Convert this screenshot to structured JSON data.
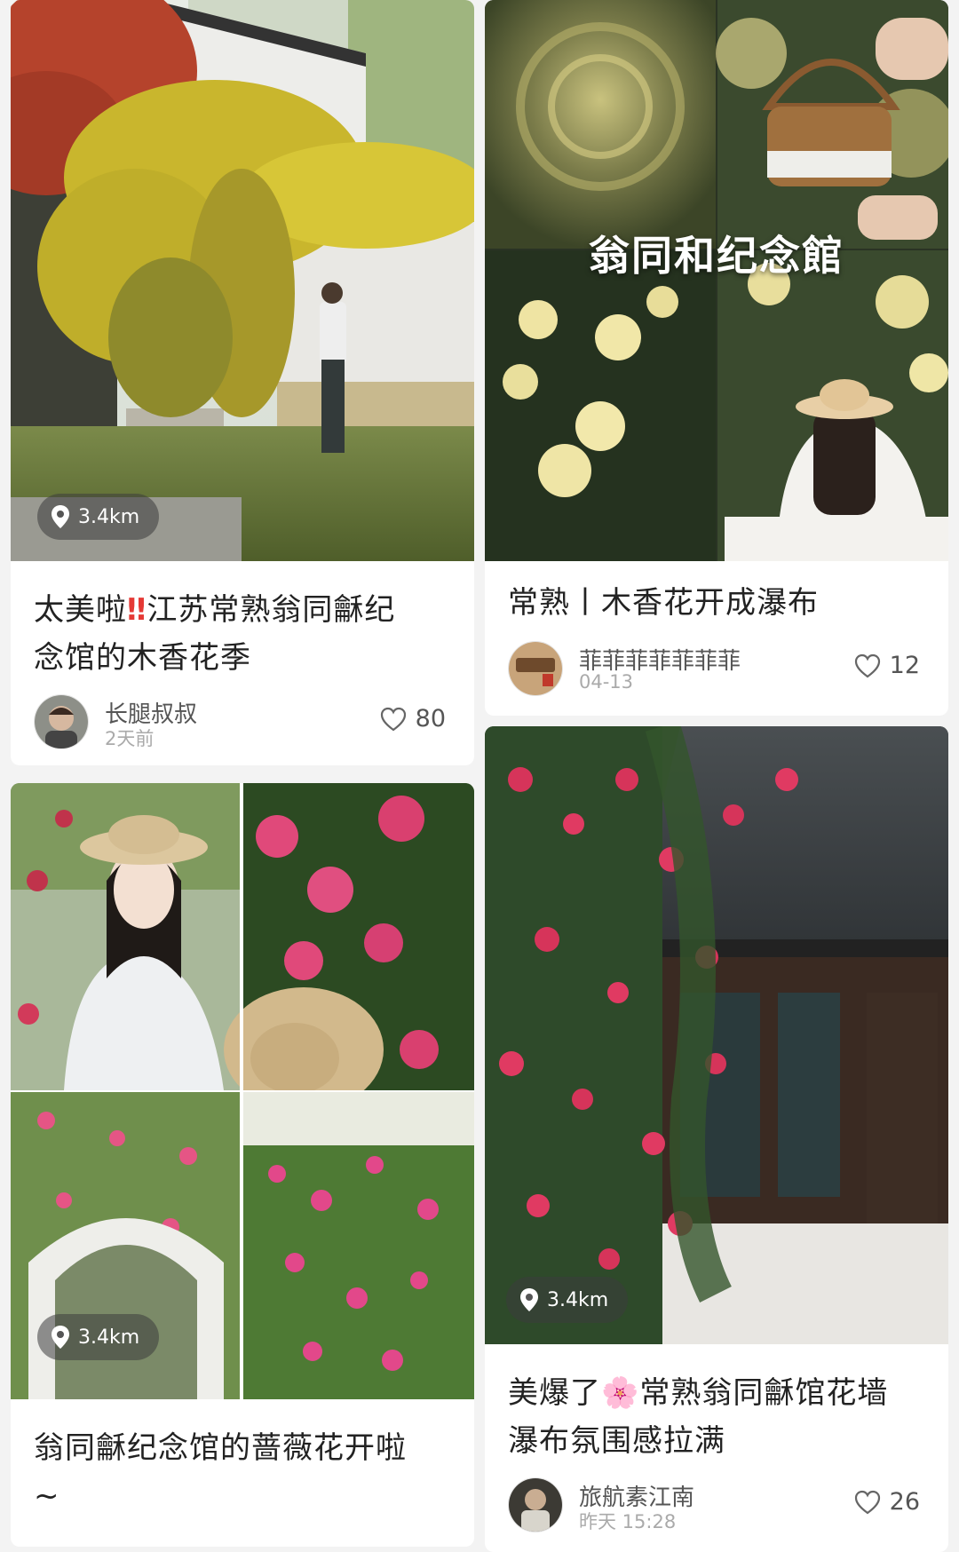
{
  "cards": [
    {
      "title": "太美啦‼️江苏常熟翁同龢纪念馆的木香花季",
      "title_parts": [
        "太美啦",
        "‼",
        "江苏常熟翁同龢纪",
        "念馆的木香花季"
      ],
      "distance": "3.4km",
      "author": "长腿叔叔",
      "time": "2天前",
      "likes": "80"
    },
    {
      "title": "常熟丨木香花开成瀑布",
      "overlay_text": "翁同和纪念館",
      "author": "菲菲菲菲菲菲菲",
      "time": "04-13",
      "likes": "12"
    },
    {
      "title": "翁同龢纪念馆的蔷薇花开啦~",
      "title_parts": [
        "翁同龢纪念馆的蔷薇花开啦",
        "~"
      ],
      "distance": "3.4km"
    },
    {
      "title": "美爆了🌸常熟翁同龢馆花墙瀑布氛围感拉满",
      "title_parts": [
        "美爆了",
        "🌸",
        "常熟翁同龢馆花墙",
        "瀑布氛围感拉满"
      ],
      "distance": "3.4km",
      "author": "旅航素江南",
      "time": "昨天 15:28",
      "likes": "26"
    }
  ],
  "icons": {
    "location": "location-pin-icon",
    "like": "heart-outline-icon"
  },
  "colors": {
    "background": "#f3f3f3",
    "card": "#ffffff",
    "text": "#222222",
    "muted": "#aaaaaa",
    "exclaim": "#e53935"
  }
}
